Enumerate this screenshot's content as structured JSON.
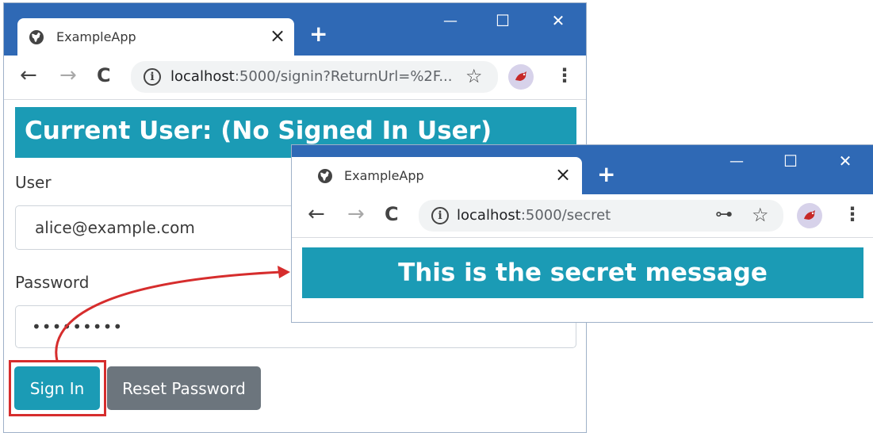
{
  "back_window": {
    "tab_title": "ExampleApp",
    "tab_close": "×",
    "new_tab": "+",
    "controls": {
      "minimize": "—",
      "maximize": "☐",
      "close": "✕"
    },
    "url_host": "localhost",
    "url_rest": ":5000/signin?ReturnUrl=%2F...",
    "banner": "Current User: (No Signed In User)",
    "user_label": "User",
    "user_value": "alice@example.com",
    "password_label": "Password",
    "password_value": "•••••••••",
    "sign_in_button": "Sign In",
    "reset_password_button": "Reset Password"
  },
  "front_window": {
    "tab_title": "ExampleApp",
    "tab_close": "×",
    "new_tab": "+",
    "controls": {
      "minimize": "—",
      "maximize": "☐",
      "close": "✕"
    },
    "url_host": "localhost",
    "url_rest": ":5000/secret",
    "banner": "This is the secret message"
  },
  "glyphs": {
    "back": "←",
    "forward": "→",
    "reload": "C",
    "info": "i",
    "star": "☆",
    "menu": "⋮",
    "key": "⊶"
  },
  "colors": {
    "titlebar": "#2f69b5",
    "banner": "#1b9bb5",
    "primary_button": "#1b9bb5",
    "secondary_button": "#6c757d",
    "annotation": "#d62d2d"
  }
}
